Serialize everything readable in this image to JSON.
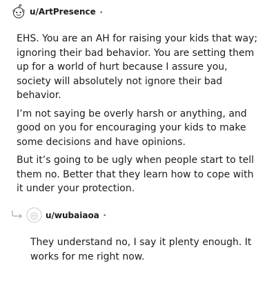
{
  "comment": {
    "username": "u/ArtPresence",
    "separator": "•",
    "paragraphs": [
      "EHS. You are an AH for raising your kids that way; ignoring their bad behavior. You are setting them up for a world of hurt because I assure you, society will absolutely not ignore their bad behavior.",
      "I’m not saying be overly harsh or anything, and good on you for encouraging your kids to make some decisions and have opinions.",
      "But it’s going to be ugly when people start to tell them no. Better that they learn how to cope with it under your protection."
    ]
  },
  "reply": {
    "username": "u/wubaiaoa",
    "separator": "•",
    "paragraphs": [
      "They understand no, I say it plenty enough. It works for me right now."
    ]
  },
  "colors": {
    "text": "#1c1c1c",
    "muted": "#7c7c7c"
  },
  "icons": {
    "avatar1": "reddit-snoo-avatar",
    "avatar2": "default-avatar",
    "reply": "reply-arrow-icon"
  }
}
